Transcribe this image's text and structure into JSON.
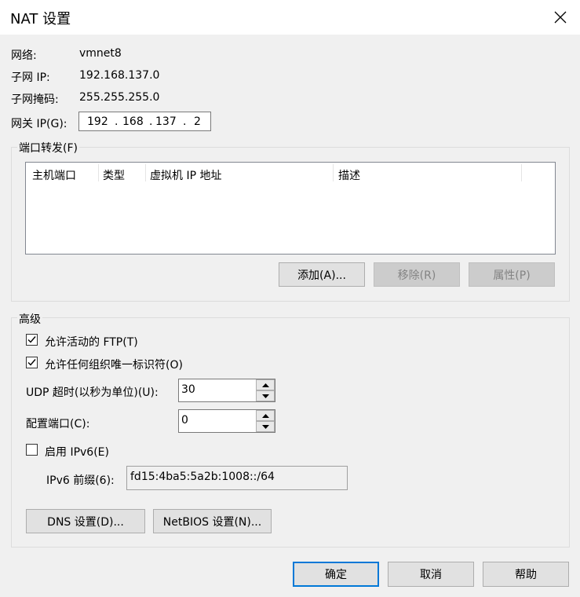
{
  "dialog": {
    "title": "NAT 设置"
  },
  "info": {
    "network_label": "网络:",
    "network_value": "vmnet8",
    "subnet_ip_label": "子网 IP:",
    "subnet_ip_value": "192.168.137.0",
    "subnet_mask_label": "子网掩码:",
    "subnet_mask_value": "255.255.255.0",
    "gateway_label": "网关 IP(G):",
    "gateway_octets": [
      "192",
      "168",
      "137",
      "2"
    ]
  },
  "port_forwarding": {
    "group_label": "端口转发(F)",
    "columns": [
      "主机端口",
      "类型",
      "虚拟机 IP 地址",
      "描述"
    ],
    "add_button": "添加(A)...",
    "remove_button": "移除(R)",
    "properties_button": "属性(P)"
  },
  "advanced": {
    "group_label": "高级",
    "allow_ftp_label": "允许活动的 FTP(T)",
    "allow_ftp_checked": true,
    "allow_oui_label": "允许任何组织唯一标识符(O)",
    "allow_oui_checked": true,
    "udp_timeout_label": "UDP 超时(以秒为单位)(U):",
    "udp_timeout_value": "30",
    "config_port_label": "配置端口(C):",
    "config_port_value": "0",
    "enable_ipv6_label": "启用 IPv6(E)",
    "enable_ipv6_checked": false,
    "ipv6_prefix_label": "IPv6 前缀(6):",
    "ipv6_prefix_value": "fd15:4ba5:5a2b:1008::/64",
    "dns_button": "DNS 设置(D)...",
    "netbios_button": "NetBIOS 设置(N)..."
  },
  "footer": {
    "ok_button": "确定",
    "cancel_button": "取消",
    "help_button": "帮助"
  }
}
